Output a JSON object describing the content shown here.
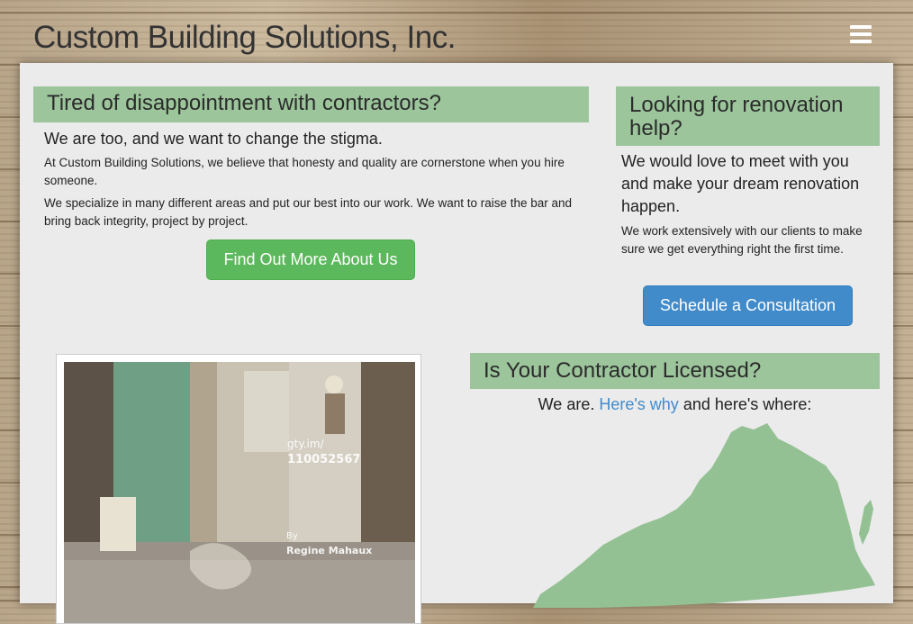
{
  "header": {
    "site_title": "Custom Building Solutions, Inc.",
    "menu_icon": "hamburger-menu-icon"
  },
  "main": {
    "section1": {
      "heading": "Tired of disappointment with contractors?",
      "lead": "We are too, and we want to change the stigma.",
      "paragraph1": "At Custom Building Solutions, we believe that honesty and quality are cornerstone when you hire someone.",
      "paragraph2": "We specialize in many different areas and put our best into our work. We want to raise the bar and bring back integrity, project by project.",
      "button_label": "Find Out More About Us"
    },
    "section2": {
      "heading": "Looking for renovation help?",
      "lead": "We would love to meet with you and make your dream renovation happen.",
      "paragraph": "We work extensively with our clients to make sure we get everything right the first time.",
      "button_label": "Schedule a Consultation"
    },
    "section3": {
      "heading": "Is Your Contractor Licensed?",
      "text_before": "We are. ",
      "link_text": "Here's why",
      "text_after": " and here's where:"
    },
    "photo": {
      "overlay_url_line1": "gty.im/",
      "overlay_url_line2": "110052567",
      "overlay_by": "By",
      "overlay_author": "Regine Mahaux"
    }
  },
  "colors": {
    "accent_green": "#9cc59c",
    "button_green": "#5cb85c",
    "button_blue": "#428bca",
    "map_green": "#93c193"
  }
}
